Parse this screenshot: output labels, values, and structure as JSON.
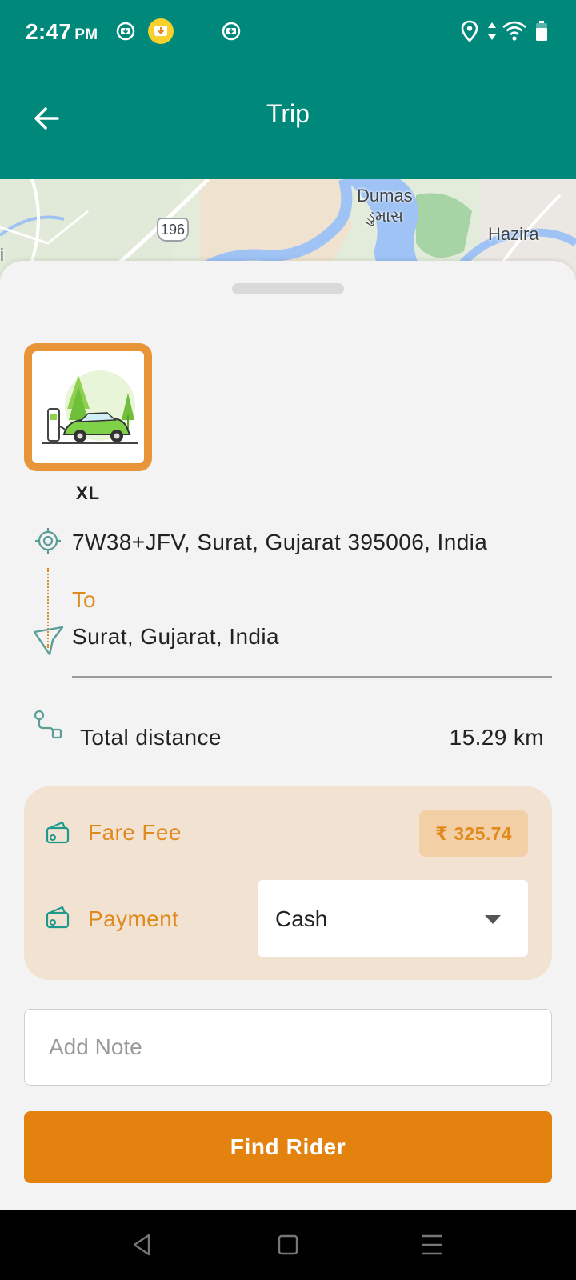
{
  "status_bar": {
    "time": "2:47",
    "ampm": "PM",
    "icons": [
      "download-notification-icon",
      "download-notification-icon",
      "download-notification-icon",
      "location-icon",
      "data-arrows-icon",
      "wifi-icon",
      "battery-icon"
    ]
  },
  "toolbar": {
    "title": "Trip",
    "back_icon": "arrow-left-icon"
  },
  "map": {
    "labels": {
      "dumas": "Dumas",
      "dumas_gujarati": "ડુમાસ",
      "hazira": "Hazira",
      "route_shield": "196",
      "edge_letter": "i"
    }
  },
  "vehicle": {
    "label": "XL",
    "icon": "car-charging-icon"
  },
  "trip": {
    "pickup": "7W38+JFV, Surat, Gujarat 395006, India",
    "to_label": "To",
    "dropoff": "Surat, Gujarat, India"
  },
  "distance": {
    "label": "Total distance",
    "value": "15.29 km"
  },
  "fare": {
    "fare_label": "Fare Fee",
    "fare_value": "₹ 325.74",
    "payment_label": "Payment",
    "payment_selected": "Cash"
  },
  "note": {
    "placeholder": "Add Note"
  },
  "actions": {
    "find_rider": "Find Rider"
  },
  "colors": {
    "primary": "#00897b",
    "accent": "#e4820f",
    "fare_bg": "#f2e2d2"
  }
}
